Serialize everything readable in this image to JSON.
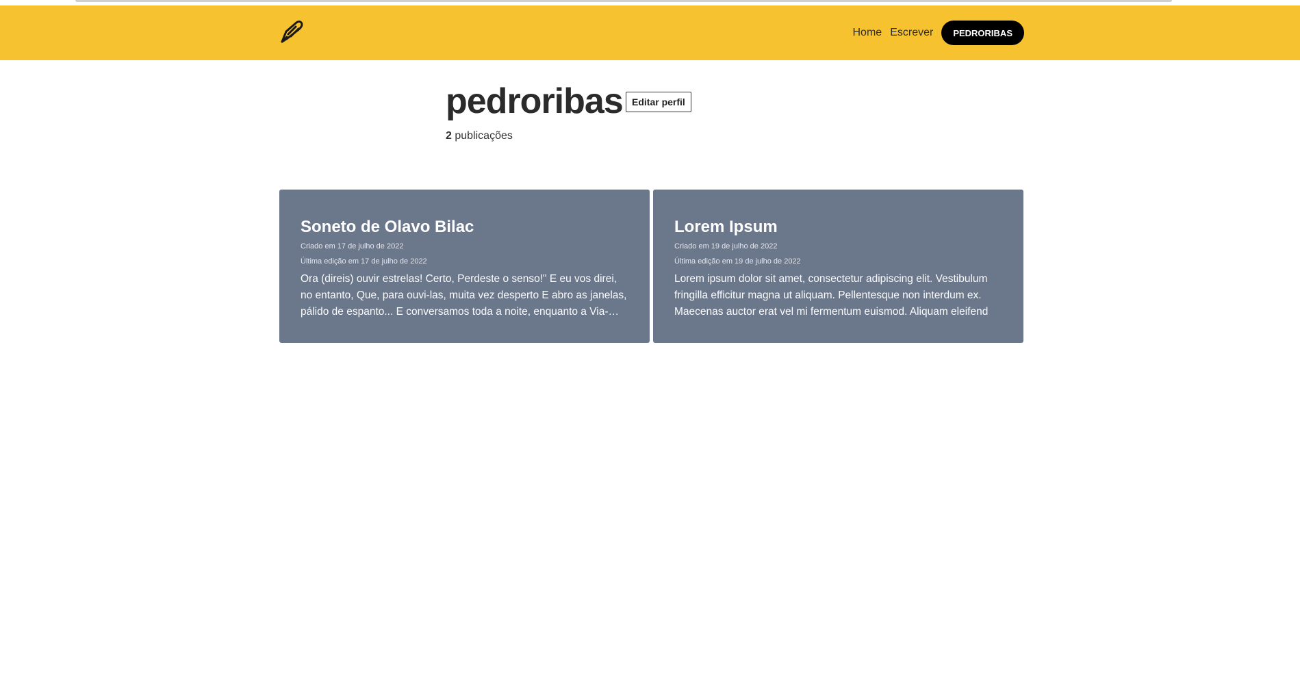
{
  "nav": {
    "logo_icon": "quill-pen-icon",
    "links": [
      "Home",
      "Escrever"
    ],
    "user_button": "PEDRORIBAS"
  },
  "profile": {
    "username": "pedroribas",
    "edit_label": "Editar perfil",
    "post_count": "2",
    "post_count_label": "publicações"
  },
  "posts": [
    {
      "title": "Soneto de Olavo Bilac",
      "created": "Criado em 17 de julho de 2022",
      "edited": "Última edição em 17 de julho de 2022",
      "excerpt": "Ora (direis) ouvir estrelas! Certo, Perdeste o senso!\" E eu vos direi, no entanto, Que, para ouvi-las, muita vez desperto E abro as janelas, pálido de espanto... E conversamos toda a noite, enquanto a Via-Láctea"
    },
    {
      "title": "Lorem Ipsum",
      "created": "Criado em 19 de julho de 2022",
      "edited": "Última edição em 19 de julho de 2022",
      "excerpt": "Lorem ipsum dolor sit amet, consectetur adipiscing elit. Vestibulum fringilla efficitur magna ut aliquam. Pellentesque non interdum ex. Maecenas auctor erat vel mi fermentum euismod. Aliquam eleifend"
    }
  ],
  "colors": {
    "header": "#f6c22f",
    "card": "#6b788c",
    "user_button": "#000000"
  }
}
